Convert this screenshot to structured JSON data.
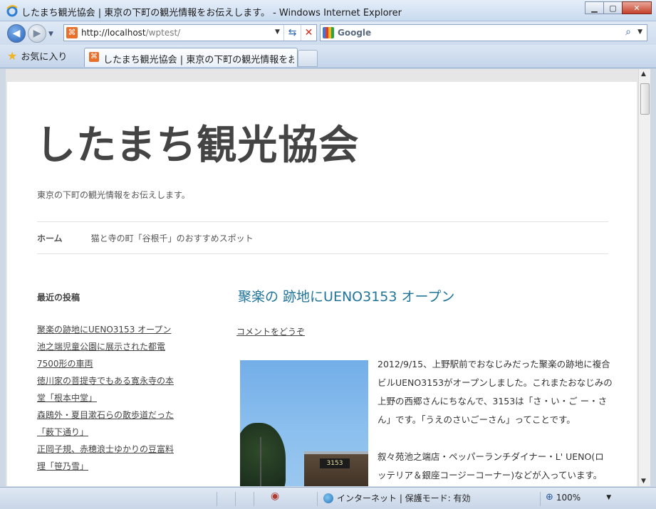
{
  "window": {
    "title": "したまち観光協会 | 東京の下町の観光情報をお伝えします。 - Windows Internet Explorer",
    "minimize": "▁",
    "maximize": "▢",
    "close": "✕"
  },
  "address": {
    "host": "http://localhost",
    "path": "/wptest/"
  },
  "search": {
    "provider": "Google"
  },
  "favorites": {
    "label": "お気に入り"
  },
  "tab": {
    "title": "したまち観光協会 | 東京の下町の観光情報をお..."
  },
  "site": {
    "title": "したまち観光協会",
    "description": "東京の下町の観光情報をお伝えします。",
    "menu": [
      {
        "label": "ホーム"
      },
      {
        "label": "猫と寺の町「谷根千」のおすすめスポット"
      }
    ]
  },
  "sidebar": {
    "title": "最近の投稿",
    "lines": [
      "聚楽の跡地にUENO3153 オープン",
      "池之端児童公園に展示された都電",
      "7500形の車両",
      "徳川家の菩提寺でもある寛永寺の本",
      "堂「根本中堂」",
      "森鴎外・夏目漱石らの散歩道だった",
      "「薮下通り」",
      "正岡子規、赤穂浪士ゆかりの豆富料",
      "理「笹乃雪」"
    ]
  },
  "post": {
    "title": "聚楽の 跡地にUENO3153 オープン",
    "comment_link": "コメントをどうぞ",
    "photo_sign": "3153",
    "paragraph1": "2012/9/15、上野駅前でおなじみだった聚楽の跡地に複合ビルUENO3153がオープンしました。これまたおなじみの上野の西郷さんにちなんで、3153は「さ・い・ご ー・さん」です。「うえのさいごーさん」ってことです。",
    "paragraph2": "叙々苑池之端店・ペッパーランチダイナー・L' UENO(ロッテリア＆銀座コージーコーナー)などが入っています。"
  },
  "status": {
    "zone": "インターネット | 保護モード: 有効",
    "zoom": "100%"
  }
}
